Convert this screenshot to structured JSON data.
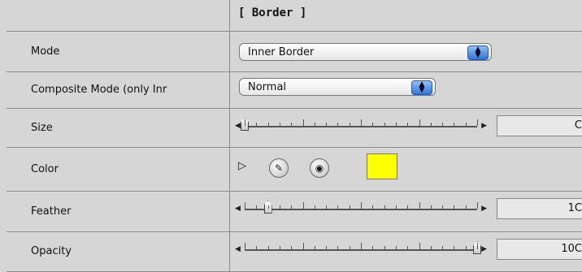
{
  "header": {
    "title": "[ Border ]"
  },
  "rows": {
    "mode": {
      "label": "Mode",
      "value": "Inner Border"
    },
    "composite": {
      "label": "Composite Mode (only Inr",
      "value": "Normal"
    },
    "size": {
      "label": "Size",
      "value": "C",
      "level": 0.0
    },
    "color": {
      "label": "Color",
      "swatch": "#ffff00"
    },
    "feather": {
      "label": "Feather",
      "value": "1C",
      "level": 0.1
    },
    "opacity": {
      "label": "Opacity",
      "value": "10C",
      "level": 1.0
    }
  },
  "icons": {
    "disclosure": "disclosure-triangle-icon",
    "eyedropper": "eyedropper-icon",
    "color_wheel": "color-wheel-icon"
  }
}
